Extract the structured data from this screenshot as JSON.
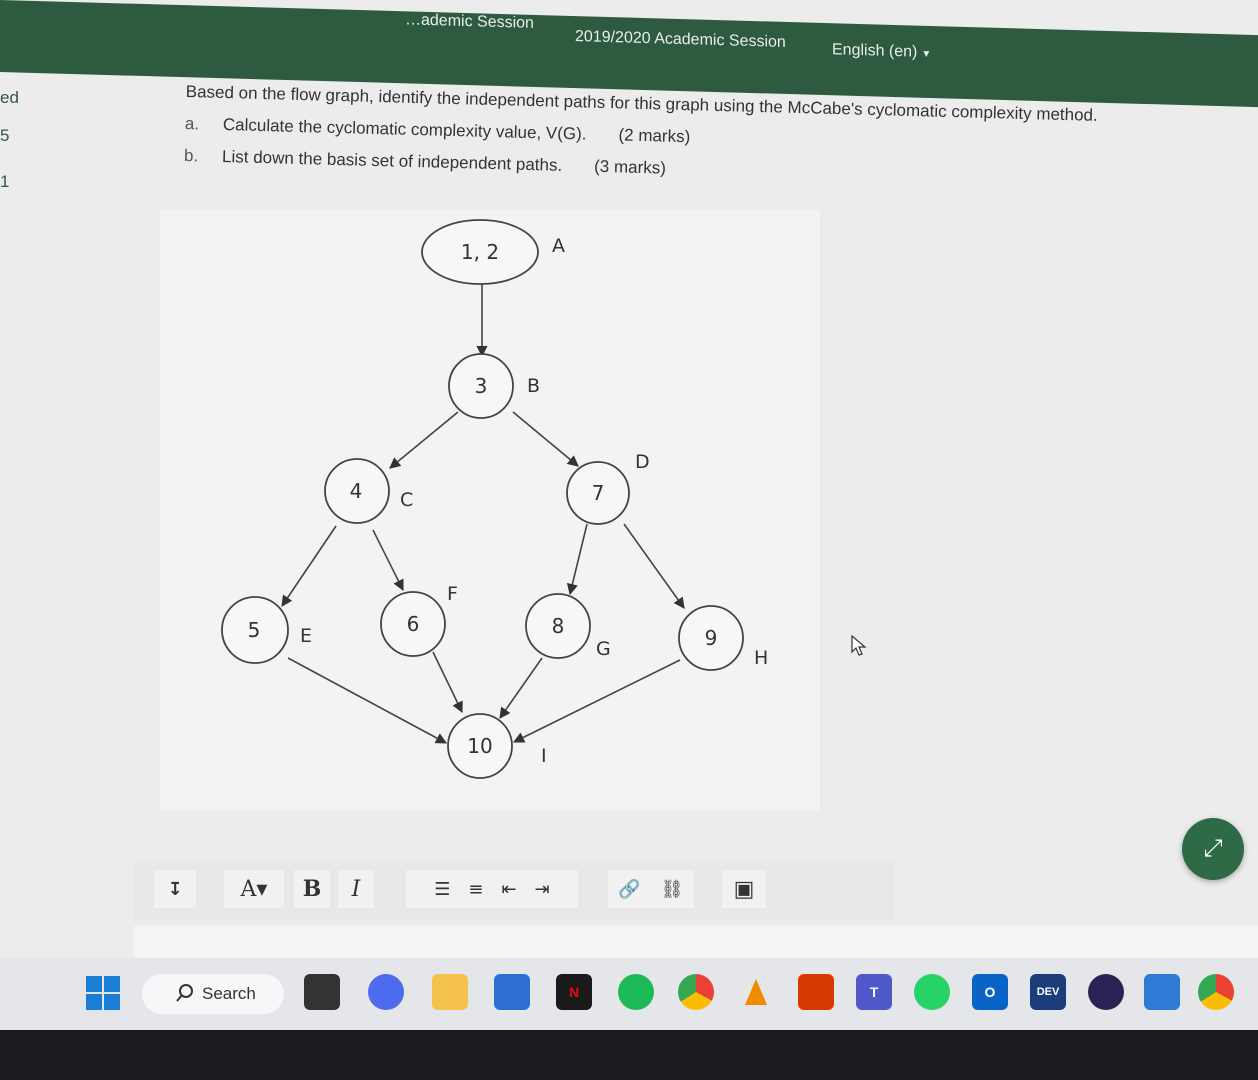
{
  "header": {
    "crumb_prev": "…ademic Session",
    "crumb_current": "2019/2020 Academic Session",
    "language": "English (en)"
  },
  "sidebar_fragments": [
    "ed",
    "5",
    "1"
  ],
  "question": {
    "intro": "Based on the flow graph, identify the independent paths for this graph using the McCabe's cyclomatic complexity method.",
    "items": [
      {
        "letter": "a.",
        "text": "Calculate the cyclomatic complexity value, V(G).",
        "marks": "(2 marks)"
      },
      {
        "letter": "b.",
        "text": "List down the basis set of independent paths.",
        "marks": "(3 marks)"
      }
    ]
  },
  "graph": {
    "nodes": [
      {
        "id": "n12",
        "label": "1, 2",
        "region": "A"
      },
      {
        "id": "n3",
        "label": "3",
        "region": "B"
      },
      {
        "id": "n4",
        "label": "4",
        "region": "C"
      },
      {
        "id": "n7",
        "label": "7",
        "region": "D"
      },
      {
        "id": "n5",
        "label": "5",
        "region": "E"
      },
      {
        "id": "n6",
        "label": "6",
        "region": "F"
      },
      {
        "id": "n8",
        "label": "8",
        "region": "G"
      },
      {
        "id": "n9",
        "label": "9",
        "region": "H"
      },
      {
        "id": "n10",
        "label": "10",
        "region": "I"
      }
    ],
    "edges": [
      [
        "1, 2",
        "3"
      ],
      [
        "3",
        "4"
      ],
      [
        "3",
        "7"
      ],
      [
        "4",
        "5"
      ],
      [
        "4",
        "6"
      ],
      [
        "7",
        "8"
      ],
      [
        "7",
        "9"
      ],
      [
        "5",
        "10"
      ],
      [
        "6",
        "10"
      ],
      [
        "8",
        "10"
      ],
      [
        "9",
        "10"
      ]
    ]
  },
  "toolbar": {
    "collapse_glyph": "↧",
    "font_glyph": "A▾",
    "bold_glyph": "B",
    "italic_glyph": "I",
    "ul_glyph": "☰",
    "ol_glyph": "≡",
    "outdent_glyph": "⇤",
    "indent_glyph": "⇥",
    "link_glyph": "🔗",
    "unlink_glyph": "⛓",
    "image_glyph": "▣"
  },
  "fab": {
    "glyph": "⤢"
  },
  "taskbar": {
    "search_label": "Search",
    "apps": [
      "file-explorer",
      "video-chat",
      "folder",
      "store",
      "netflix",
      "spotify",
      "chrome",
      "vlc",
      "office",
      "teams",
      "whatsapp",
      "outlook",
      "dev",
      "eclipse",
      "photos",
      "chrome-profile"
    ],
    "dev_label": "DEV",
    "netflix_label": "N",
    "teams_label": "T",
    "outlook_label": "O"
  }
}
